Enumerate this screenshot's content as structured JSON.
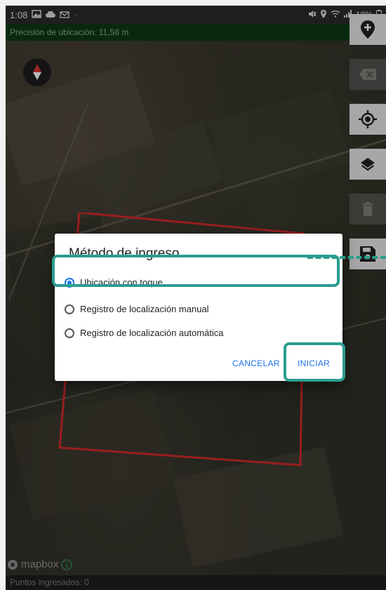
{
  "status_bar": {
    "time": "1:08",
    "battery": "18%"
  },
  "precision_bar": {
    "text": "Precisión de ubicación: 11,58 m"
  },
  "map": {
    "attribution": "mapbox"
  },
  "dialog": {
    "title": "Método de ingreso",
    "options": [
      {
        "label": "Ubicación con toque",
        "checked": true
      },
      {
        "label": "Registro de localización manual",
        "checked": false
      },
      {
        "label": "Registro de localización automática",
        "checked": false
      }
    ],
    "cancel_label": "CANCELAR",
    "start_label": "INICIAR"
  },
  "bottom_bar": {
    "text": "Puntos ingresados: 0"
  },
  "colors": {
    "highlight": "#2a9d8f",
    "accent": "#1a73e8",
    "polygon": "#d42a2a",
    "precision_bg": "#0d3a12"
  }
}
